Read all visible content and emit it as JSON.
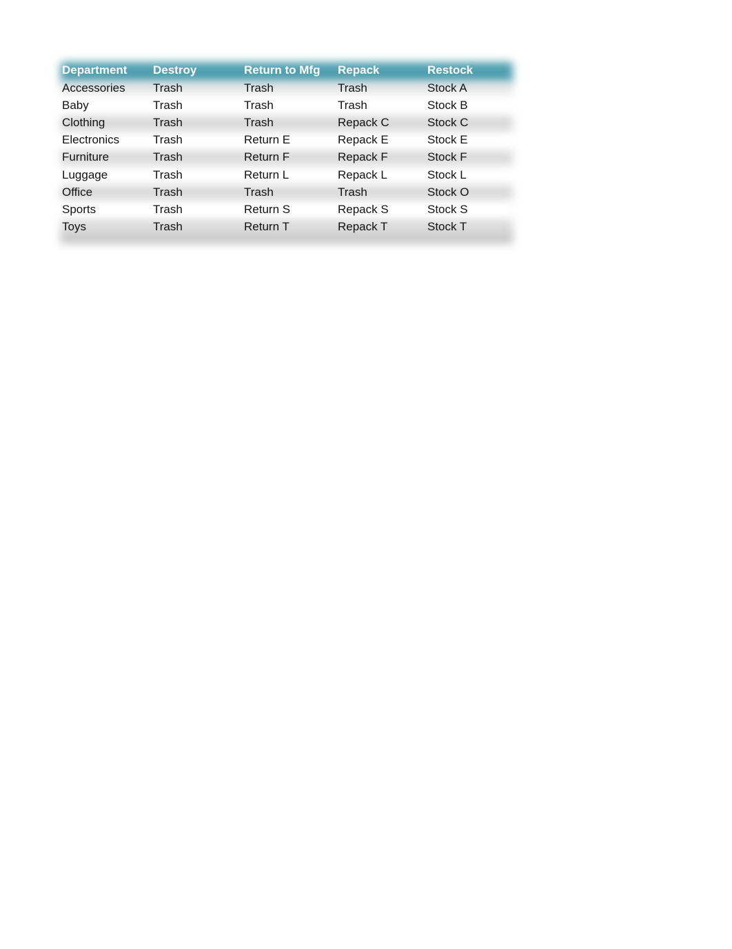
{
  "table": {
    "columns": [
      "Department",
      "Destroy",
      "Return to Mfg",
      "Repack",
      "Restock"
    ],
    "rows": [
      [
        "Accessories",
        "Trash",
        "Trash",
        "Trash",
        "Stock A"
      ],
      [
        "Baby",
        "Trash",
        "Trash",
        "Trash",
        "Stock B"
      ],
      [
        "Clothing",
        "Trash",
        "Trash",
        "Repack C",
        "Stock C"
      ],
      [
        "Electronics",
        "Trash",
        "Return E",
        "Repack E",
        "Stock E"
      ],
      [
        "Furniture",
        "Trash",
        "Return F",
        "Repack F",
        "Stock F"
      ],
      [
        "Luggage",
        "Trash",
        "Return L",
        "Repack L",
        "Stock L"
      ],
      [
        "Office",
        "Trash",
        "Trash",
        "Trash",
        "Stock O"
      ],
      [
        "Sports",
        "Trash",
        "Return S",
        "Repack S",
        "Stock S"
      ],
      [
        "Toys",
        "Trash",
        "Return T",
        "Repack T",
        "Stock T"
      ]
    ]
  },
  "colors": {
    "header_background": "#4f9fb0",
    "header_text": "#ffffff",
    "body_text": "#111111"
  }
}
